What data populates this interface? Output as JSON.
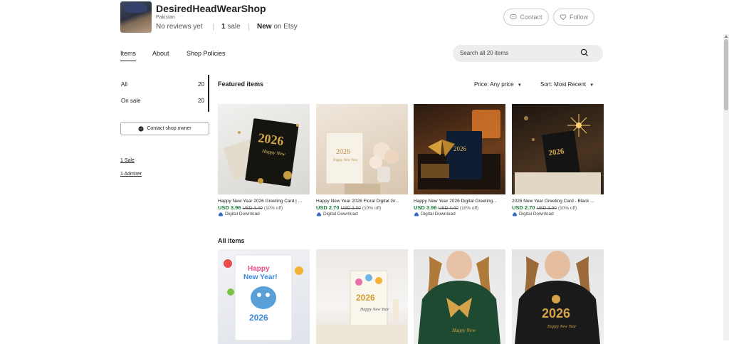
{
  "header": {
    "shop_name": "DesiredHeadWearShop",
    "location": "Pakistan",
    "reviews": "No reviews yet",
    "sales_count": "1",
    "sales_label": "sale",
    "new_strong": "New",
    "new_rest": "on Etsy",
    "contact_label": "Contact",
    "follow_label": "Follow"
  },
  "tabs": [
    {
      "label": "Items"
    },
    {
      "label": "About"
    },
    {
      "label": "Shop Policies"
    }
  ],
  "search": {
    "placeholder": "Search all 20 items"
  },
  "sidebar": {
    "items": [
      {
        "label": "All",
        "count": "20"
      },
      {
        "label": "On sale",
        "count": "20"
      }
    ],
    "contact_owner": "Contact shop owner",
    "links": [
      "1 Sale",
      "1 Admirer"
    ]
  },
  "featured": {
    "title": "Featured items",
    "price_filter": "Price: Any price",
    "sort_filter": "Sort: Most Recent",
    "cards": [
      {
        "title": "Happy New Year 2026 Greeting Card | ...",
        "price": "USD 3.96",
        "was": "USD 4.40",
        "off": "(10% off)",
        "download": "Digital Download"
      },
      {
        "title": "Happy New Year 2026 Floral Digital Gr...",
        "price": "USD 2.70",
        "was": "USD 3.00",
        "off": "(10% off)",
        "download": "Digital Download"
      },
      {
        "title": "Happy New Year 2026 Digital Greeting...",
        "price": "USD 3.96",
        "was": "USD 4.40",
        "off": "(10% off)",
        "download": "Digital Download"
      },
      {
        "title": "2026 New Year Greeting Card - Black ...",
        "price": "USD 2.70",
        "was": "USD 3.00",
        "off": "(10% off)",
        "download": "Digital Download"
      }
    ]
  },
  "all_items": {
    "title": "All items"
  },
  "colors": {
    "price_green": "#1b7e3c",
    "accent": "#222222"
  }
}
